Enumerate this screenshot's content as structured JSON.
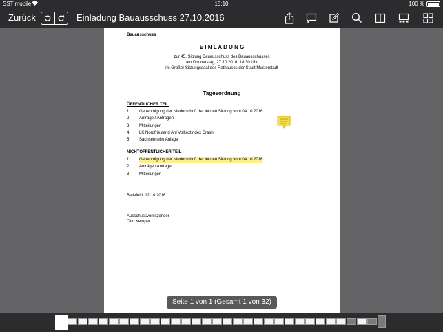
{
  "status": {
    "carrier": "SST mobile",
    "time": "15:10",
    "battery": "100 %"
  },
  "nav": {
    "back": "Zurück",
    "title": "Einladung Bauausschuss 27.10.2016"
  },
  "doc": {
    "org": "Bauausschuss",
    "heading": "E I N L A D U N G",
    "intro": [
      "zur 45. Sitzung Bauausschuss des Bauausschusses",
      "am Donnerstag, 27.10.2016, 18:30 Uhr",
      "im Großer Sitzungssaal des Rathauses der Stadt Musterstadt"
    ],
    "agenda_title": "Tagesordnung",
    "public_title": "ÖFFENTLICHER TEIL",
    "public_items": [
      {
        "num": "1.",
        "text": "Genehmigung der Niederschrift der letzten Sitzung vom 04.10.2016"
      },
      {
        "num": "2.",
        "text": "Anträge / Anfragen"
      },
      {
        "num": "3.",
        "text": "Mitteilungen"
      },
      {
        "num": "4.",
        "text": "LK Nordfriesland Anl Volltextindex Crash"
      },
      {
        "num": "5.",
        "text": "Sachsenheim Anlage"
      }
    ],
    "private_title": "NICHTÖFFENTLICHER TEIL",
    "private_items": [
      {
        "num": "1.",
        "text": "Genehmigung der Niederschrift der letzten Sitzung vom 04.10.2016"
      },
      {
        "num": "2.",
        "text": "Anträge / Anfrage"
      },
      {
        "num": "3.",
        "text": "Mitteilungen"
      }
    ],
    "place_date": "Bielefeld, 12.10.2016",
    "signer_role": "Ausschussvorsitzender",
    "signer_name": "Otto Kemper"
  },
  "page_indicator": "Seite 1 von 1 (Gesamt 1 von 32)",
  "colors": {
    "ink": "#1f4fd1",
    "highlight": "#fbf08a",
    "note": "#f5df4a"
  }
}
